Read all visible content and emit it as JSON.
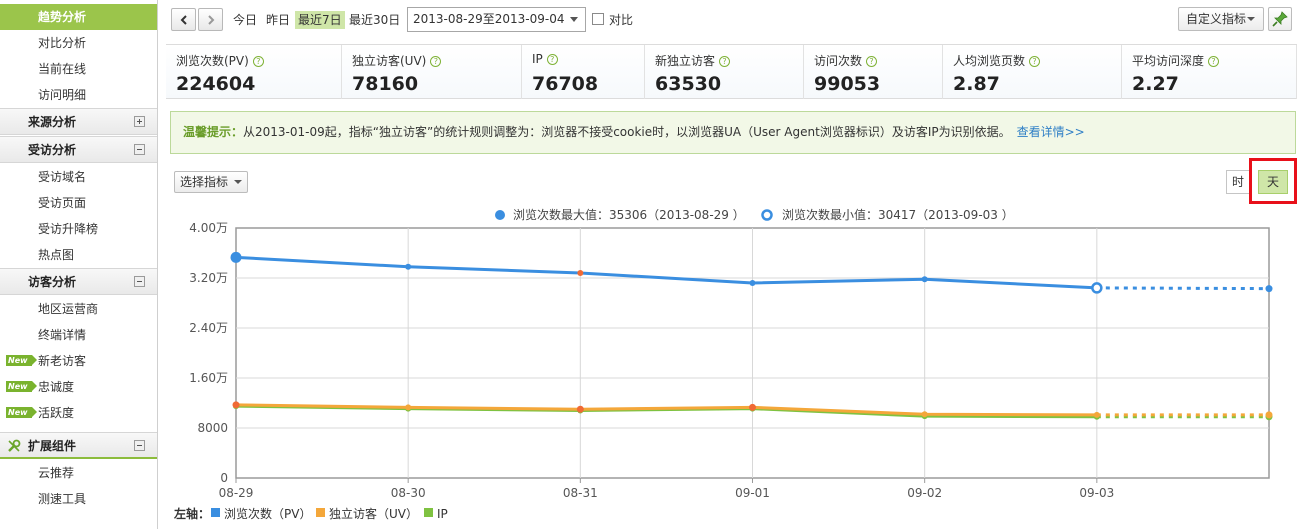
{
  "sidebar": {
    "items": [
      {
        "label": "趋势分析",
        "kind": "active"
      },
      {
        "label": "对比分析",
        "kind": "sub"
      },
      {
        "label": "当前在线",
        "kind": "sub"
      },
      {
        "label": "访问明细",
        "kind": "sub"
      },
      {
        "label": "来源分析",
        "kind": "group",
        "toggle": "plus"
      },
      {
        "label": "受访分析",
        "kind": "group",
        "toggle": "minus"
      },
      {
        "label": "受访域名",
        "kind": "sub"
      },
      {
        "label": "受访页面",
        "kind": "sub"
      },
      {
        "label": "受访升降榜",
        "kind": "sub"
      },
      {
        "label": "热点图",
        "kind": "sub"
      },
      {
        "label": "访客分析",
        "kind": "group",
        "toggle": "minus"
      },
      {
        "label": "地区运营商",
        "kind": "sub"
      },
      {
        "label": "终端详情",
        "kind": "sub"
      },
      {
        "label": "新老访客",
        "kind": "sub-new"
      },
      {
        "label": "忠诚度",
        "kind": "sub-new"
      },
      {
        "label": "活跃度",
        "kind": "sub-new"
      },
      {
        "label": "扩展组件",
        "kind": "group-ext",
        "toggle": "minus"
      },
      {
        "label": "云推荐",
        "kind": "sub"
      },
      {
        "label": "测速工具",
        "kind": "sub"
      }
    ],
    "new_badge": "New"
  },
  "toolbar": {
    "prev_icon": "chevron-left-icon",
    "next_icon": "chevron-right-icon",
    "today": "今日",
    "yesterday": "昨日",
    "last7": "最近7日",
    "last30": "最近30日",
    "date_range": "2013-08-29至2013-09-04",
    "compare_label": "对比",
    "custom_metric": "自定义指标",
    "pin_icon": "pin-icon"
  },
  "metrics": [
    {
      "label": "浏览次数(PV)",
      "value": "224604"
    },
    {
      "label": "独立访客(UV)",
      "value": "78160"
    },
    {
      "label": "IP",
      "value": "76708"
    },
    {
      "label": "新独立访客",
      "value": "63530"
    },
    {
      "label": "访问次数",
      "value": "99053"
    },
    {
      "label": "人均浏览页数",
      "value": "2.87"
    },
    {
      "label": "平均访问深度",
      "value": "2.27"
    }
  ],
  "notice": {
    "title": "温馨提示：",
    "text": "从2013-01-09起，指标“独立访客”的统计规则调整为：浏览器不接受cookie时，以浏览器UA（User Agent浏览器标识）及访客IP为识别依据。",
    "link": "查看详情>>"
  },
  "chart_controls": {
    "metric_select": "选择指标",
    "hour": "时",
    "day": "天"
  },
  "colors": {
    "accent": "#9bc54b",
    "pv": "#3a8ee0",
    "uv": "#f4a73a",
    "ip": "#7fc241",
    "highlight": "#e8101a"
  },
  "chart_data": {
    "type": "line",
    "legend_max": "浏览次数最大值：35306（2013-08-29 ）",
    "legend_min": "浏览次数最小值：30417（2013-09-03 ）",
    "y_ticks": [
      "0",
      "8000",
      "1.60万",
      "2.40万",
      "3.20万",
      "4.00万"
    ],
    "ylim": [
      0,
      40000
    ],
    "categories": [
      "08-29",
      "08-30",
      "08-31",
      "09-01",
      "09-02",
      "09-03"
    ],
    "series": [
      {
        "name": "浏览次数（PV）",
        "color": "#3a8ee0",
        "values": [
          35306,
          33800,
          32800,
          31200,
          31800,
          30417
        ],
        "projected": 30300
      },
      {
        "name": "独立访客（UV）",
        "color": "#f4a73a",
        "values": [
          11700,
          11300,
          11000,
          11300,
          10200,
          10100
        ],
        "projected": 10100
      },
      {
        "name": "IP",
        "color": "#7fc241",
        "values": [
          11500,
          11100,
          10800,
          11100,
          9900,
          9800
        ],
        "projected": 9800
      }
    ],
    "axis_title": "左轴："
  }
}
